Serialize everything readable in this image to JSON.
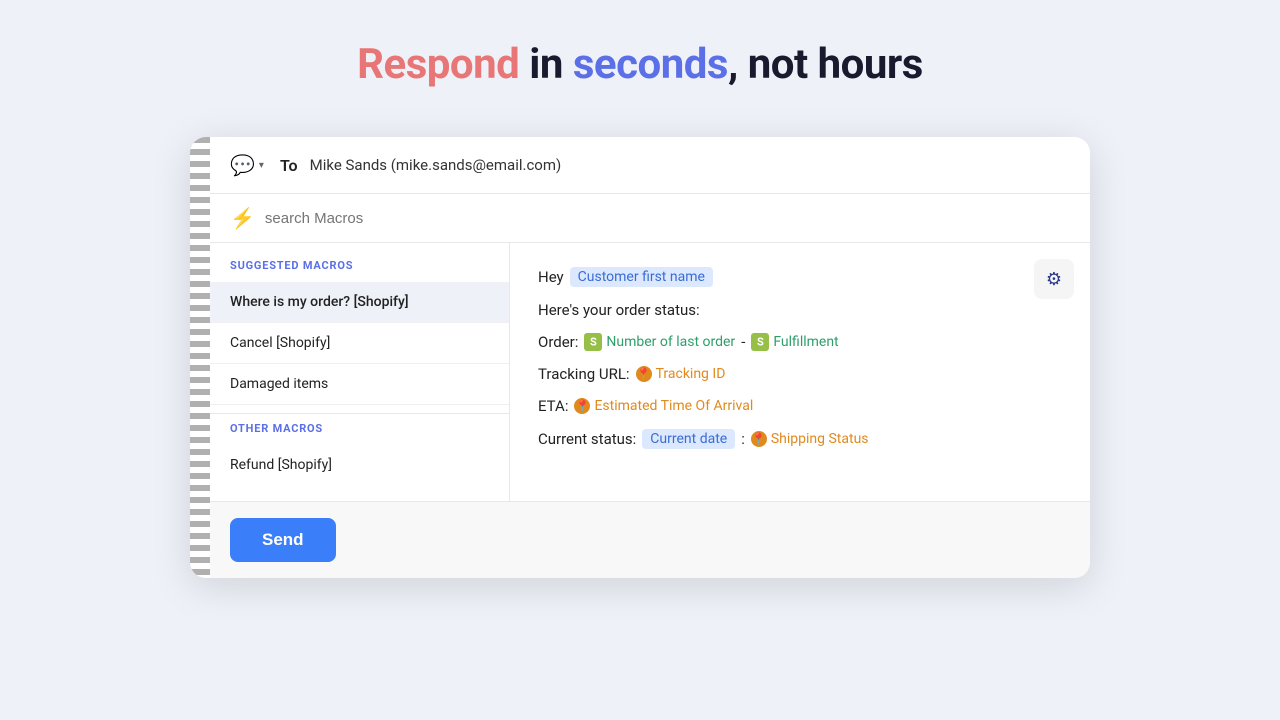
{
  "headline": {
    "respond": "Respond",
    "in": " in ",
    "seconds": "seconds",
    "comma": ",",
    "not_hours": " not hours"
  },
  "header": {
    "to_label": "To",
    "to_value": "Mike Sands (mike.sands@email.com)"
  },
  "search": {
    "placeholder": "search Macros"
  },
  "suggested_section": {
    "label": "SUGGESTED MACROS",
    "items": [
      {
        "id": "macro-1",
        "label": "Where is my order? [Shopify]",
        "active": true
      },
      {
        "id": "macro-2",
        "label": "Cancel [Shopify]",
        "active": false
      },
      {
        "id": "macro-3",
        "label": "Damaged items",
        "active": false
      }
    ]
  },
  "other_section": {
    "label": "OTHER MACROS",
    "items": [
      {
        "id": "macro-4",
        "label": "Refund [Shopify]",
        "active": false
      }
    ]
  },
  "preview": {
    "hey_label": "Hey",
    "customer_first_name_tag": "Customer first name",
    "heres_line": "Here's your order status:",
    "order_label": "Order:",
    "number_tag": "Number of last order",
    "dash": "-",
    "fulfillment_tag": "Fulfillment",
    "tracking_label": "Tracking URL:",
    "tracking_id_tag": "Tracking ID",
    "eta_label": "ETA:",
    "eta_tag": "Estimated Time Of Arrival",
    "current_status_label": "Current status:",
    "current_date_tag": "Current date",
    "colon": ":",
    "shipping_status_tag": "Shipping Status"
  },
  "footer": {
    "send_label": "Send"
  }
}
